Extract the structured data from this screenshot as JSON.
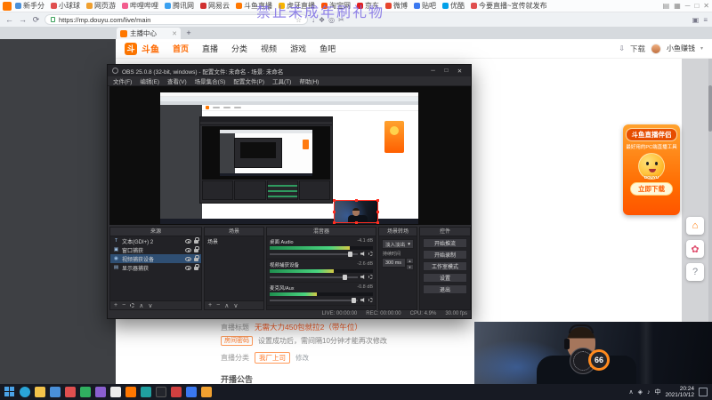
{
  "watermark": {
    "text": "禁止未成年刷礼物"
  },
  "browser": {
    "bookmarks": [
      {
        "label": "新手分",
        "color": "#4a90d9"
      },
      {
        "label": "小球球",
        "color": "#e04f4f"
      },
      {
        "label": "网页游",
        "color": "#f0a030"
      },
      {
        "label": "哔哩哔哩",
        "color": "#f25d8e"
      },
      {
        "label": "腾讯网",
        "color": "#3aa0f0"
      },
      {
        "label": "网易云",
        "color": "#d03030"
      },
      {
        "label": "斗鱼直播",
        "color": "#ff7700"
      },
      {
        "label": "虎牙直播",
        "color": "#f7b500"
      },
      {
        "label": "淘宝网",
        "color": "#ff5000"
      },
      {
        "label": "京东",
        "color": "#e02020"
      },
      {
        "label": "微博",
        "color": "#e6452f"
      },
      {
        "label": "贴吧",
        "color": "#3a78f0"
      },
      {
        "label": "优酷",
        "color": "#00a0e9"
      },
      {
        "label": "今要直播~宣传就发布",
        "color": "#e04f4f"
      }
    ],
    "toolbar": {
      "url": "https://mp.douyu.com/live/main"
    },
    "tab": {
      "title": "主播中心"
    }
  },
  "site": {
    "logo_badge": "斗",
    "logo": "斗鱼",
    "nav": [
      "首页",
      "直播",
      "分类",
      "视频",
      "游戏",
      "鱼吧"
    ],
    "download": "下载",
    "username": "小鱼赚钱"
  },
  "obs": {
    "title": "OBS 25.0.8 (32-bit, windows) - 配置文件: 未命名 - 场景: 未命名",
    "menu": [
      "文件(F)",
      "编辑(E)",
      "查看(V)",
      "场景集合(S)",
      "配置文件(P)",
      "工具(T)",
      "帮助(H)"
    ],
    "sources": {
      "title": "来源",
      "items": [
        {
          "name": "文本(GDI+) 2",
          "icon": "T"
        },
        {
          "name": "窗口捕获",
          "icon": "▣"
        },
        {
          "name": "视频捕获设备",
          "icon": "◉"
        },
        {
          "name": "显示器捕获",
          "icon": "▤"
        }
      ]
    },
    "scenes": {
      "title": "场景",
      "items": [
        {
          "name": "场景"
        }
      ]
    },
    "mixer": {
      "title": "混音器",
      "channels": [
        {
          "name": "桌面 Audio",
          "db": "-4.1 dB",
          "level": "78%"
        },
        {
          "name": "视频捕获设备",
          "db": "-2.6 dB",
          "level": "62%"
        },
        {
          "name": "麦克风/Aux",
          "db": "-0.8 dB",
          "level": "46%"
        }
      ]
    },
    "transitions": {
      "title": "场景转场",
      "value": "淡入淡出",
      "duration_label": "持续时间",
      "duration": "300 ms"
    },
    "controls": {
      "title": "控件",
      "buttons": [
        "开始推流",
        "开始录制",
        "工作室模式",
        "设置",
        "退出"
      ]
    },
    "status": {
      "live": "LIVE: 00:00:00",
      "rec": "REC: 00:00:00",
      "cpu": "CPU: 4.9%",
      "fps": "30.00 fps"
    }
  },
  "page": {
    "form": {
      "title_label": "直播标题",
      "title_value": "无需大力450包就拉2（带午位）",
      "password_tag": "房间密码",
      "password_note": "设置成功后，需间隔10分钟才能再次修改",
      "category_label": "直播分类",
      "category_value": "我厂上司",
      "edit": "修改",
      "notice": "开播公告"
    }
  },
  "ad": {
    "badge": "斗鱼直播伴侣",
    "subtitle": "最好用的PC端直播工具",
    "mascot": "DOUYU",
    "button": "立即下载"
  },
  "cam": {
    "score": "66"
  },
  "taskbar": {
    "time": "20:24",
    "date": "2021/10/12",
    "lang": "中"
  }
}
